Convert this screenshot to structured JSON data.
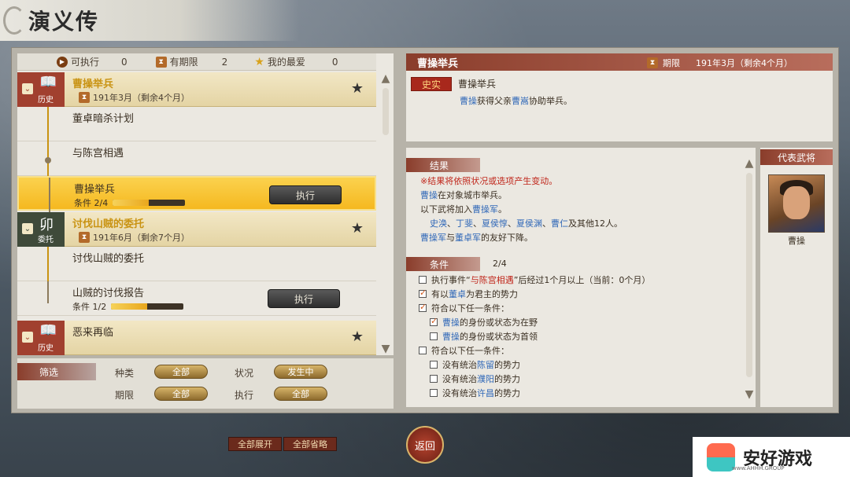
{
  "title": "演义传",
  "counts": {
    "exec_label": "可执行",
    "exec_count": "0",
    "limit_label": "有期限",
    "limit_count": "2",
    "fav_label": "我的最爱",
    "fav_count": "0"
  },
  "list": [
    {
      "type": "head",
      "badge": "历史",
      "title": "曹操举兵",
      "date": "191年3月（剩余4个月）"
    },
    {
      "type": "sub",
      "title": "董卓暗杀计划"
    },
    {
      "type": "sub",
      "title": "与陈宫相遇"
    },
    {
      "type": "sel",
      "title": "曹操举兵",
      "cond": "条件 2/4",
      "progress": 0.5,
      "exec": "执行"
    },
    {
      "type": "head",
      "badge": "委托",
      "title": "讨伐山贼的委托",
      "date": "191年6月（剩余7个月）"
    },
    {
      "type": "sub",
      "title": "讨伐山贼的委托"
    },
    {
      "type": "sub2",
      "title": "山贼的讨伐报告",
      "cond": "条件 1/2",
      "progress": 0.5,
      "exec": "执行"
    },
    {
      "type": "head",
      "badge": "历史",
      "title": "恶来再临"
    }
  ],
  "filter": {
    "label": "筛选",
    "kind": "种类",
    "kind_val": "全部",
    "status": "状况",
    "status_val": "发生中",
    "period": "期限",
    "period_val": "全部",
    "exec": "执行",
    "exec_val": "全部"
  },
  "detail": {
    "header": "曹操举兵",
    "date_label": "期限",
    "date": "191年3月（剩余4个月）",
    "tag": "史实",
    "subtitle": "曹操举兵",
    "desc_a": "曹操",
    "desc_b": "获得父亲",
    "desc_c": "曹嵩",
    "desc_d": "协助举兵。"
  },
  "result": {
    "header": "结果",
    "warn": "※结果将依照状况或选项产生变动。",
    "l1a": "曹操",
    "l1b": "在对象城市举兵。",
    "l2a": "以下武将加入",
    "l2b": "曹操军",
    "l2c": "。",
    "l3a": "史涣",
    "l3b": "、",
    "l3c": "丁斐",
    "l3d": "、",
    "l3e": "夏侯惇",
    "l3f": "、",
    "l3g": "夏侯渊",
    "l3h": "、",
    "l3i": "曹仁",
    "l3j": "及其他12人。",
    "l4a": "曹操军",
    "l4b": "与",
    "l4c": "董卓军",
    "l4d": "的友好下降。"
  },
  "cond": {
    "header": "条件",
    "count": "2/4",
    "c1a": "执行事件“",
    "c1b": "与陈宫相遇",
    "c1c": "”后经过1个月以上（当前：0个月）",
    "c2a": "有以",
    "c2b": "董卓",
    "c2c": "为君主的势力",
    "c3": "符合以下任一条件：",
    "c4a": "曹操",
    "c4b": "的身份或状态为在野",
    "c5a": "曹操",
    "c5b": "的身份或状态为首领",
    "c6": "符合以下任一条件：",
    "c7a": "没有统治",
    "c7b": "陈留",
    "c7c": "的势力",
    "c8a": "没有统治",
    "c8b": "濮阳",
    "c8c": "的势力",
    "c9a": "没有统治",
    "c9b": "许昌",
    "c9c": "的势力"
  },
  "general": {
    "header": "代表武将",
    "name": "曹操"
  },
  "bottom": {
    "expand": "全部展开",
    "collapse": "全部省略",
    "back": "返回"
  },
  "logo": {
    "text": "安好游戏",
    "sub": "www.AHHH.GROUP"
  }
}
